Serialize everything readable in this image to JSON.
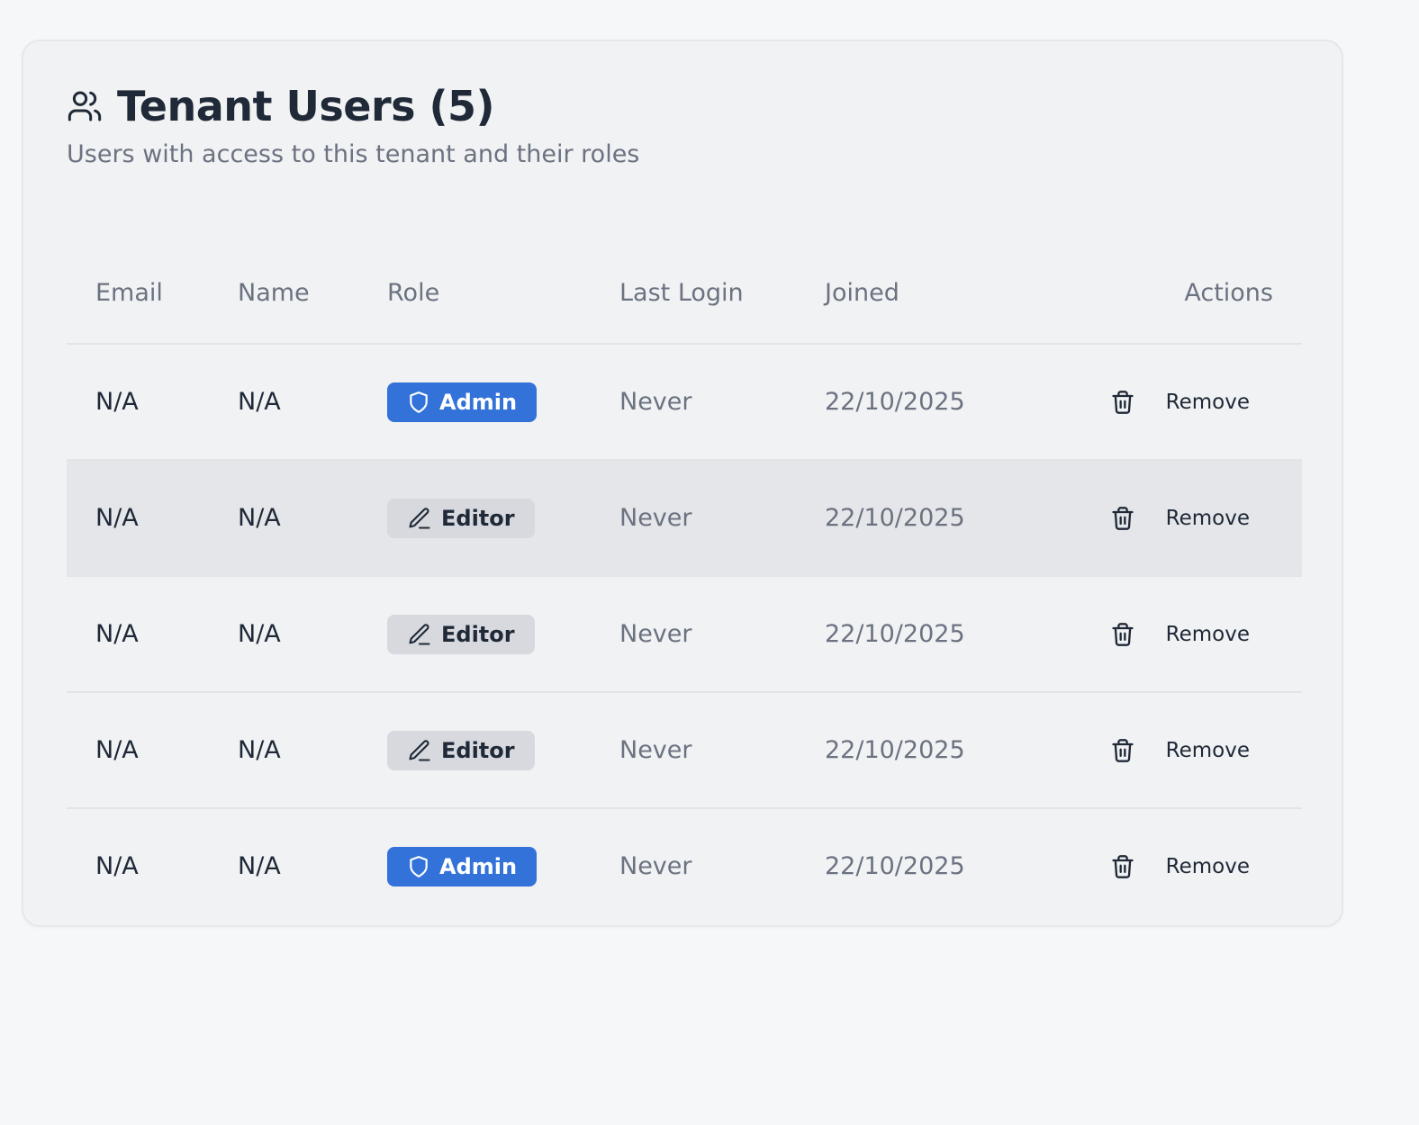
{
  "header": {
    "icon": "users-icon",
    "title": "Tenant Users (5)",
    "subtitle": "Users with access to this tenant and their roles"
  },
  "table": {
    "columns": {
      "email": "Email",
      "name": "Name",
      "role": "Role",
      "last_login": "Last Login",
      "joined": "Joined",
      "actions": "Actions"
    },
    "rows": [
      {
        "email": "N/A",
        "name": "N/A",
        "role": "Admin",
        "role_icon": "shield-icon",
        "last_login": "Never",
        "joined": "22/10/2025",
        "action": "Remove"
      },
      {
        "email": "N/A",
        "name": "N/A",
        "role": "Editor",
        "role_icon": "pencil-icon",
        "last_login": "Never",
        "joined": "22/10/2025",
        "action": "Remove"
      },
      {
        "email": "N/A",
        "name": "N/A",
        "role": "Editor",
        "role_icon": "pencil-icon",
        "last_login": "Never",
        "joined": "22/10/2025",
        "action": "Remove"
      },
      {
        "email": "N/A",
        "name": "N/A",
        "role": "Editor",
        "role_icon": "pencil-icon",
        "last_login": "Never",
        "joined": "22/10/2025",
        "action": "Remove"
      },
      {
        "email": "N/A",
        "name": "N/A",
        "role": "Admin",
        "role_icon": "shield-icon",
        "last_login": "Never",
        "joined": "22/10/2025",
        "action": "Remove"
      }
    ]
  },
  "colors": {
    "admin_badge": "#3272d9",
    "editor_badge": "#d7d9de",
    "hovered_row": "#e5e6e9"
  }
}
